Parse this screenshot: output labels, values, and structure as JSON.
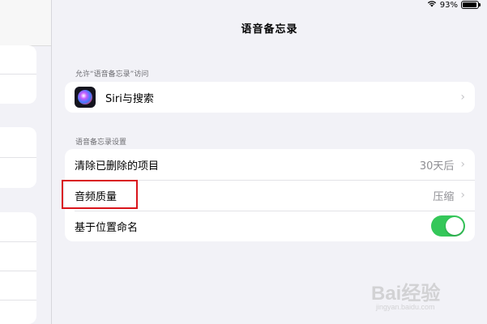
{
  "status_bar": {
    "battery_text": "93%",
    "battery_level": 0.93,
    "icons": [
      "wifi-icon",
      "battery-icon"
    ]
  },
  "title": "语音备忘录",
  "section_access": {
    "header": "允许“语音备忘录”访问",
    "items": [
      {
        "label": "Siri与搜索",
        "icon": "siri-icon"
      }
    ]
  },
  "section_settings": {
    "header": "语音备忘录设置",
    "items": [
      {
        "label": "清除已删除的项目",
        "value": "30天后"
      },
      {
        "label": "音频质量",
        "value": "压缩"
      },
      {
        "label": "基于位置命名",
        "toggle_on": true
      }
    ]
  },
  "annotation": {
    "highlight_color": "#d9141b",
    "highlighted_item": "音频质量"
  },
  "watermark": {
    "main": "Bai经验",
    "sub": "jingyan.baidu.com"
  },
  "colors": {
    "toggle_on": "#34c759",
    "background": "#f2f2f7",
    "secondary_text": "#8e8e93"
  }
}
